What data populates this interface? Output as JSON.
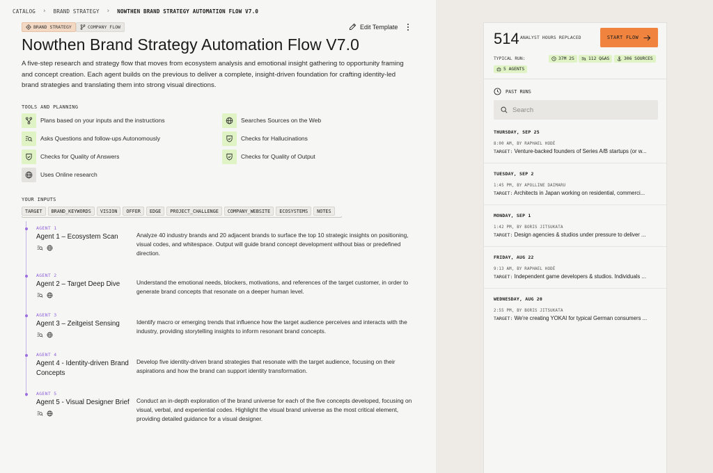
{
  "breadcrumb": {
    "items": [
      "CATALOG",
      "BRAND STRATEGY",
      "NOWTHEN BRAND STRATEGY AUTOMATION FLOW V7.0"
    ]
  },
  "tags": {
    "brand": "BRAND STRATEGY",
    "flow": "COMPANY FLOW"
  },
  "actions": {
    "edit_template": "Edit Template"
  },
  "page": {
    "title": "Nowthen Brand Strategy Automation Flow V7.0",
    "description": "A five-step research and strategy flow that moves from ecosystem analysis and emotional insight gathering to opportunity framing and concept creation. Each agent builds on the previous to deliver a complete, insight-driven foundation for crafting identity-led brand strategies and translating them into strong visual directions."
  },
  "tools": {
    "label": "TOOLS AND PLANNING",
    "items": [
      {
        "label": "Plans based on your inputs and the instructions",
        "icon": "branch-icon"
      },
      {
        "label": "Searches Sources on the Web",
        "icon": "globe-icon"
      },
      {
        "label": "Asks Questions and follow-ups Autonomously",
        "icon": "list-search-icon"
      },
      {
        "label": "Checks for Hallucinations",
        "icon": "shield-check-icon"
      },
      {
        "label": "Checks for Quality of Answers",
        "icon": "shield-check-icon"
      },
      {
        "label": "Checks for Quality of Output",
        "icon": "shield-check-icon"
      },
      {
        "label": "Uses Online research",
        "icon": "globe-icon"
      }
    ]
  },
  "inputs": {
    "label": "YOUR INPUTS",
    "items": [
      "TARGET",
      "BRAND_KEYWORDS",
      "VISION",
      "OFFER",
      "EDGE",
      "PROJECT_CHALLENGE",
      "COMPANY_WEBSITE",
      "ECOSYSTEMS",
      "NOTES"
    ]
  },
  "agents": [
    {
      "num": "AGENT 1",
      "name": "Agent 1 – Ecosystem Scan",
      "desc": "Analyze 40 industry brands and 20 adjacent brands to surface the top 10 strategic insights on positioning, visual codes, and whitespace. Output will guide brand concept development without bias or predefined direction."
    },
    {
      "num": "AGENT 2",
      "name": "Agent 2 – Target Deep Dive",
      "desc": "Understand the emotional needs, blockers, motivations, and references of the target customer, in order to generate brand concepts that resonate on a deeper human level."
    },
    {
      "num": "AGENT 3",
      "name": "Agent 3 – Zeitgeist Sensing",
      "desc": "Identify macro or emerging trends that influence how the target audience perceives and interacts with the industry, providing storytelling insights to inform resonant brand concepts."
    },
    {
      "num": "AGENT 4",
      "name": "Agent 4 - Identity-driven Brand Concepts",
      "desc": "Develop five identity-driven brand strategies that resonate with the target audience, focusing on their aspirations and how the brand can support identity transformation."
    },
    {
      "num": "AGENT 5",
      "name": "Agent 5 - Visual Designer Brief",
      "desc": "Conduct an in-depth exploration of the brand universe for each of the five concepts developed, focusing on visual, verbal, and experiential codes. Highlight the visual brand universe as the most critical element, providing detailed guidance for a visual designer."
    }
  ],
  "summary": {
    "hours": "514",
    "hours_label": "ANALYST HOURS REPLACED",
    "start_label": "START FLOW",
    "typical_label": "TYPICAL RUN:",
    "duration": "37M 2S",
    "qas": "112 Q&AS",
    "sources": "306 SOURCES",
    "agents": "5 AGENTS"
  },
  "past_runs": {
    "label": "PAST RUNS",
    "search_placeholder": "Search",
    "runs": [
      {
        "date": "THURSDAY, SEP 25",
        "meta": "8:00 AM, BY RAPHAEL HODÉ",
        "target_label": "TARGET:",
        "target": "Venture-backed founders of Series A/B startups (or w..."
      },
      {
        "date": "TUESDAY, SEP 2",
        "meta": "1:45 PM, BY APOLLINE DAIMARU",
        "target_label": "TARGET:",
        "target": "Architects in Japan working on residential, commerci..."
      },
      {
        "date": "MONDAY, SEP 1",
        "meta": "1:42 PM, BY BORIS JITSUKATA",
        "target_label": "TARGET:",
        "target": "Design agencies & studios under pressure to deliver ..."
      },
      {
        "date": "FRIDAY, AUG 22",
        "meta": "9:13 AM, BY RAPHAEL HODÉ",
        "target_label": "TARGET:",
        "target": "Independent game developers & studios. Individuals ..."
      },
      {
        "date": "WEDNESDAY, AUG 20",
        "meta": "2:55 PM, BY BORIS JITSUKATA",
        "target_label": "TARGET:",
        "target": "We're creating YOKAI for typical German consumers ..."
      }
    ]
  }
}
